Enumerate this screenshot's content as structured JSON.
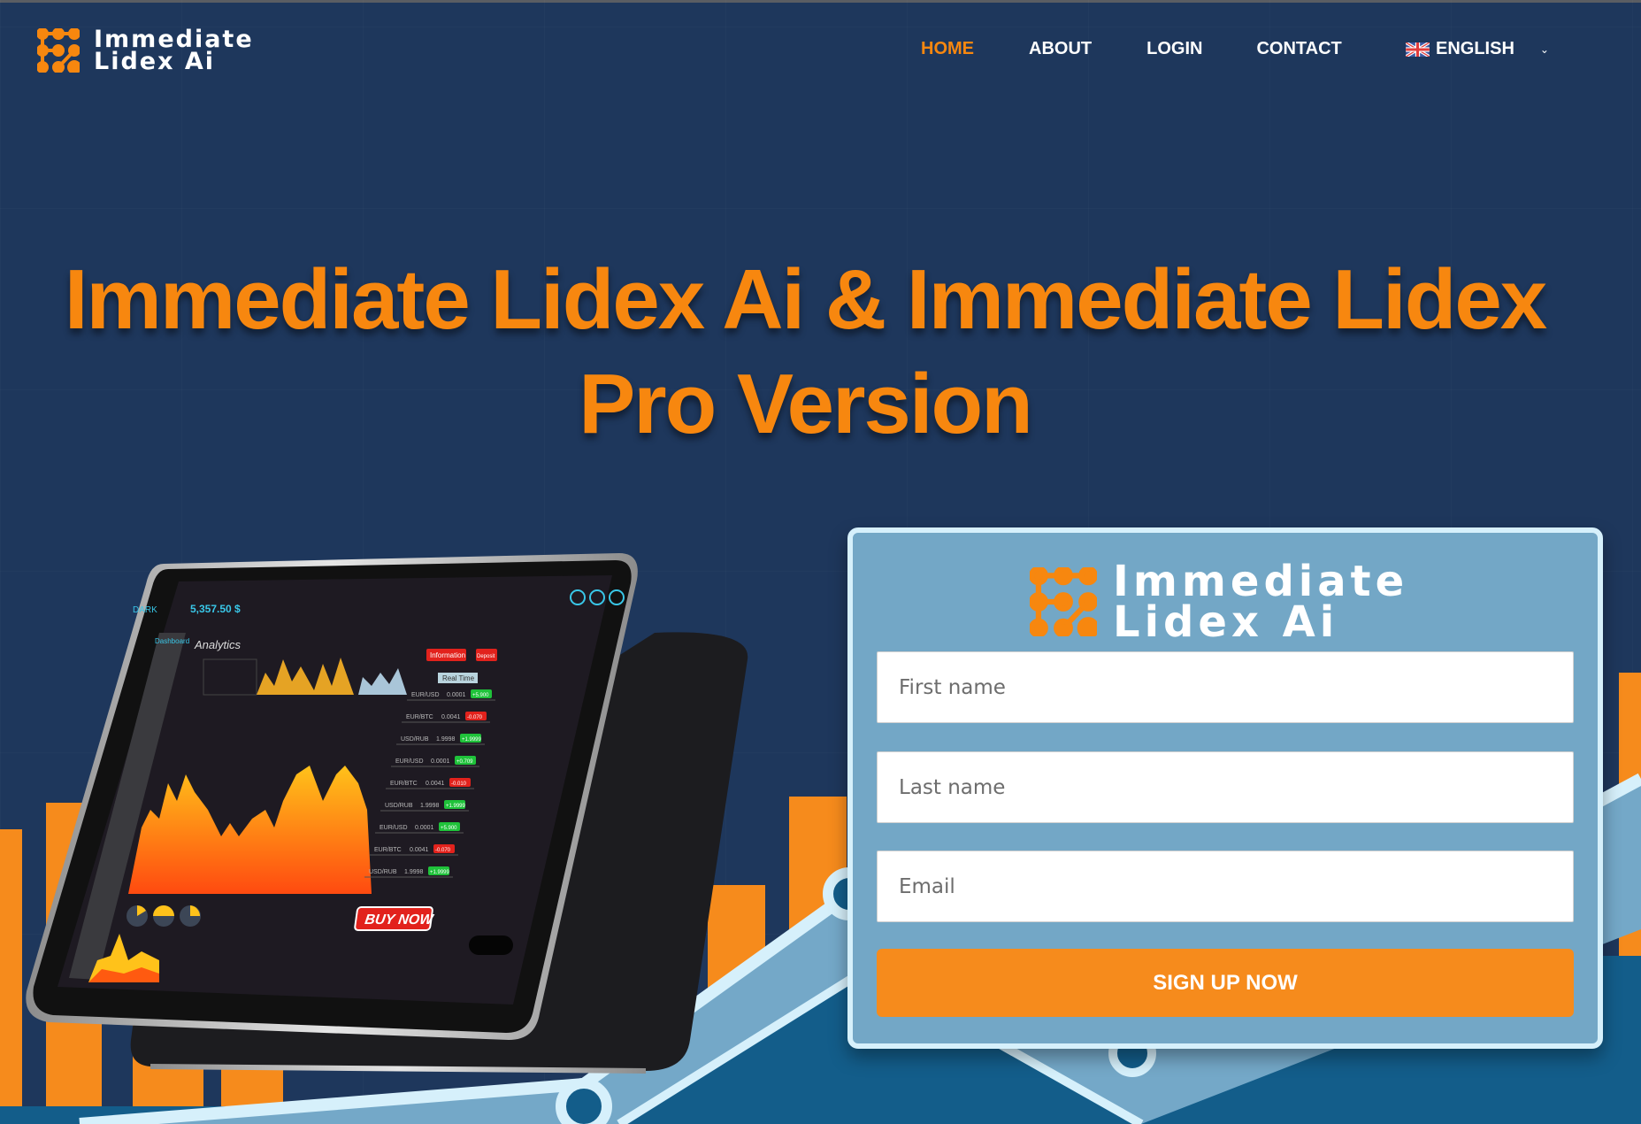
{
  "brand": {
    "name_line1": "Immediate",
    "name_line2": "Lidex Ai"
  },
  "nav": {
    "items": [
      {
        "label": "HOME",
        "active": true
      },
      {
        "label": "ABOUT",
        "active": false
      },
      {
        "label": "LOGIN",
        "active": false
      },
      {
        "label": "CONTACT",
        "active": false
      }
    ],
    "language": {
      "label": "ENGLISH",
      "flag": "uk-flag-icon",
      "chevron": "chevron-down-icon"
    }
  },
  "hero": {
    "title_line1": "Immediate Lidex Ai & Immediate Lidex",
    "title_line2": "Pro Version"
  },
  "tablet_screen": {
    "balance": "5,357.50 $",
    "section_title": "Analytics",
    "sidebar_active": "Dashboard",
    "buttons": [
      "Information",
      "Deposit"
    ],
    "realtime_label": "Real Time",
    "tickers": [
      {
        "pair": "EUR/USD",
        "value": "0.0001",
        "change": "+5.900",
        "up": true
      },
      {
        "pair": "EUR/BTC",
        "value": "0.0041",
        "change": "-0.070",
        "up": false
      },
      {
        "pair": "USD/RUB",
        "value": "1.9998",
        "change": "+1.9999",
        "up": true
      },
      {
        "pair": "EUR/USD",
        "value": "0.0001",
        "change": "+0.709",
        "up": true
      },
      {
        "pair": "EUR/BTC",
        "value": "0.0041",
        "change": "-0.010",
        "up": false
      },
      {
        "pair": "USD/RUB",
        "value": "1.9998",
        "change": "+1.9999",
        "up": true
      },
      {
        "pair": "EUR/USD",
        "value": "0.0001",
        "change": "+5.900",
        "up": true
      },
      {
        "pair": "EUR/BTC",
        "value": "0.0041",
        "change": "-0.070",
        "up": false
      },
      {
        "pair": "USD/RUB",
        "value": "1.9998",
        "change": "+1.9999",
        "up": true
      }
    ],
    "buy_button": "BUY NOW"
  },
  "form": {
    "first_name_placeholder": "First name",
    "last_name_placeholder": "Last name",
    "email_placeholder": "Email",
    "first_name_value": "",
    "last_name_value": "",
    "email_value": "",
    "submit_label": "SIGN UP NOW"
  },
  "colors": {
    "background": "#1e375c",
    "accent_orange": "#f7870f",
    "button_orange": "#f68b1c",
    "form_fill": "#73a7c6",
    "form_border": "#d6f0fb",
    "chart_band": "#74a8c8",
    "chart_dark": "#135d8a"
  }
}
